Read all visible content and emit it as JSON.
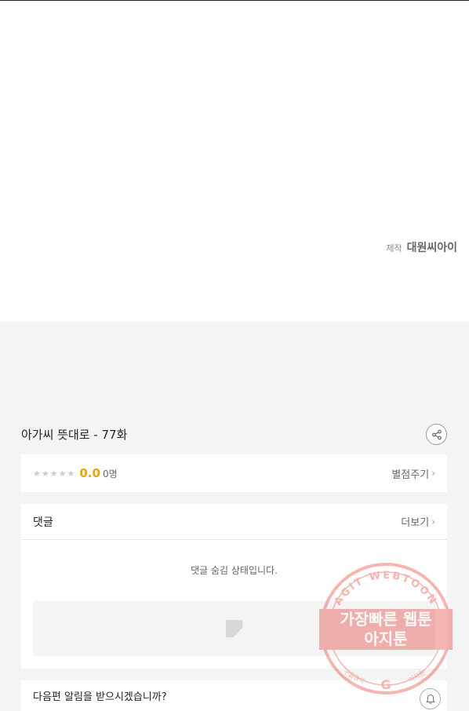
{
  "producer": {
    "label": "제작",
    "name": "대원씨아이"
  },
  "episode": {
    "title": "아가씨 뜻대로 - 77화",
    "share_icon": "share-icon"
  },
  "rating": {
    "score": "0.0",
    "count": "0명",
    "stars_filled": 0,
    "stars_total": 5,
    "action_label": "별점주기"
  },
  "comments": {
    "title": "댓글",
    "more_label": "더보기",
    "hidden_notice": "댓글 숨김 상태입니다."
  },
  "notification": {
    "prompt": "다음편 알림을 받으시겠습니까?",
    "bell_icon": "bell-icon"
  },
  "watermark": {
    "ring_text": "AGIT WEBTOON",
    "line1": "가장빠른 웹툰",
    "line2": "아지툰",
    "footer_left": "구글검색",
    "footer_right": "아지툰",
    "color": "#e8524a"
  },
  "colors": {
    "accent": "#e8a417",
    "background": "#f4f4f4"
  }
}
